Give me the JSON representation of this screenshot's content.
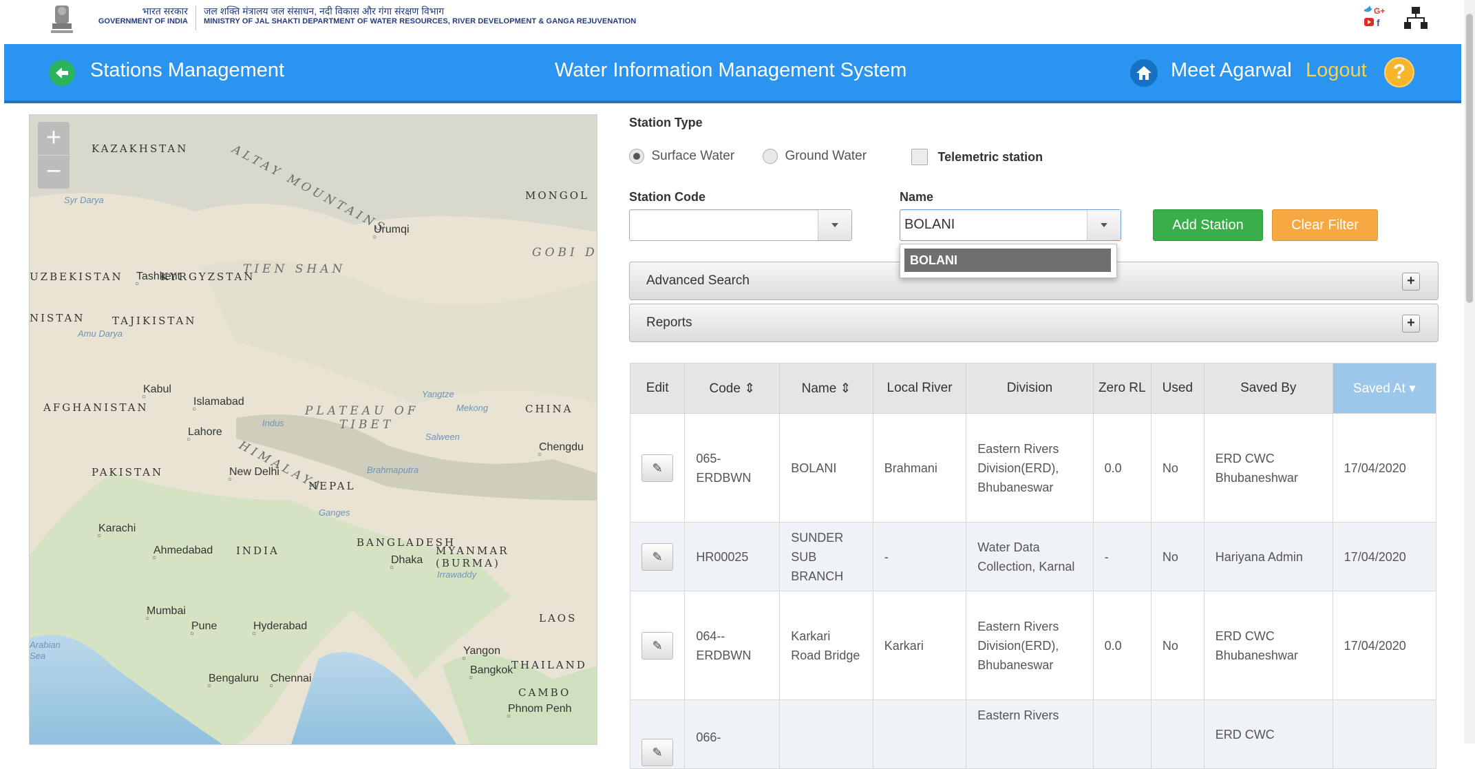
{
  "gov": {
    "hindi": "भारत सरकार",
    "english": "GOVERNMENT OF INDIA",
    "ministry_hindi": "जल शक्ति मंत्रालय जल संसाधन, नदी विकास और गंगा संरक्षण विभाग",
    "ministry_english": "MINISTRY OF JAL SHAKTI DEPARTMENT OF WATER RESOURCES, RIVER DEVELOPMENT & GANGA REJUVENATION"
  },
  "header": {
    "page_title": "Stations Management",
    "app_title": "Water Information Management System",
    "user": "Meet Agarwal",
    "logout": "Logout",
    "help": "?"
  },
  "map": {
    "zoom_in": "+",
    "zoom_out": "−",
    "labels": [
      {
        "text": "KAZAKHSTAN",
        "cls": "country"
      },
      {
        "text": "ALTAY MOUNTAINS",
        "cls": "region"
      },
      {
        "text": "MONGOL",
        "cls": "country"
      },
      {
        "text": "Syr Darya",
        "cls": "water"
      },
      {
        "text": "Urumqi",
        "cls": "city"
      },
      {
        "text": "GOBI D",
        "cls": "region"
      },
      {
        "text": "UZBEKISTAN",
        "cls": "country"
      },
      {
        "text": "Tashkent",
        "cls": "city"
      },
      {
        "text": "KYRGYZSTAN",
        "cls": "country"
      },
      {
        "text": "TIEN SHAN",
        "cls": "region"
      },
      {
        "text": "NISTAN",
        "cls": "country"
      },
      {
        "text": "TAJIKISTAN",
        "cls": "country"
      },
      {
        "text": "Amu Darya",
        "cls": "water"
      },
      {
        "text": "Kabul",
        "cls": "city"
      },
      {
        "text": "Islamabad",
        "cls": "city"
      },
      {
        "text": "AFGHANISTAN",
        "cls": "country"
      },
      {
        "text": "PLATEAU OF",
        "cls": "region"
      },
      {
        "text": "TIBET",
        "cls": "region"
      },
      {
        "text": "CHINA",
        "cls": "country"
      },
      {
        "text": "Yangtze",
        "cls": "water"
      },
      {
        "text": "Mekong",
        "cls": "water"
      },
      {
        "text": "Indus",
        "cls": "water"
      },
      {
        "text": "Lahore",
        "cls": "city"
      },
      {
        "text": "HIMALAYA",
        "cls": "region"
      },
      {
        "text": "Salween",
        "cls": "water"
      },
      {
        "text": "Chengdu",
        "cls": "city"
      },
      {
        "text": "Brahmaputra",
        "cls": "water"
      },
      {
        "text": "PAKISTAN",
        "cls": "country"
      },
      {
        "text": "New Delhi",
        "cls": "city"
      },
      {
        "text": "NEPAL",
        "cls": "country"
      },
      {
        "text": "Ganges",
        "cls": "water"
      },
      {
        "text": "Karachi",
        "cls": "city"
      },
      {
        "text": "BANGLADESH",
        "cls": "country"
      },
      {
        "text": "Ahmedabad",
        "cls": "city"
      },
      {
        "text": "INDIA",
        "cls": "country"
      },
      {
        "text": "Dhaka",
        "cls": "city"
      },
      {
        "text": "MYANMAR",
        "cls": "country"
      },
      {
        "text": "(BURMA)",
        "cls": "country"
      },
      {
        "text": "Irrawaddy",
        "cls": "water"
      },
      {
        "text": "Mumbai",
        "cls": "city"
      },
      {
        "text": "Pune",
        "cls": "city"
      },
      {
        "text": "Hyderabad",
        "cls": "city"
      },
      {
        "text": "LAOS",
        "cls": "country"
      },
      {
        "text": "Arabian",
        "cls": "water"
      },
      {
        "text": "Sea",
        "cls": "water"
      },
      {
        "text": "Yangon",
        "cls": "city"
      },
      {
        "text": "THAILAND",
        "cls": "country"
      },
      {
        "text": "Bengaluru",
        "cls": "city"
      },
      {
        "text": "Chennai",
        "cls": "city"
      },
      {
        "text": "Bangkok",
        "cls": "city"
      },
      {
        "text": "CAMBO",
        "cls": "country"
      },
      {
        "text": "Phnom Penh",
        "cls": "city"
      }
    ]
  },
  "filters": {
    "station_type_label": "Station Type",
    "surface_water": "Surface Water",
    "ground_water": "Ground Water",
    "telemetric": "Telemetric station",
    "selected_type": "Surface Water",
    "station_code_label": "Station Code",
    "station_code_value": "",
    "name_label": "Name",
    "name_value": "BOLANI",
    "name_suggestion": "BOLANI",
    "add_station": "Add Station",
    "clear_filter": "Clear Filter"
  },
  "accordions": {
    "advanced_search": "Advanced Search",
    "reports": "Reports",
    "expand": "+"
  },
  "table": {
    "headers": [
      "Edit",
      "Code ⇕",
      "Name ⇕",
      "Local River",
      "Division",
      "Zero RL",
      "Used",
      "Saved By",
      "Saved At ▾"
    ],
    "rows": [
      {
        "code": "065-ERDBWN",
        "name": "BOLANI",
        "river": "Brahmani",
        "division": "Eastern Rivers Division(ERD), Bhubaneswar",
        "zero_rl": "0.0",
        "used": "No",
        "saved_by": "ERD CWC Bhubaneshwar",
        "saved_at": "17/04/2020"
      },
      {
        "code": "HR00025",
        "name": "SUNDER SUB BRANCH",
        "river": "-",
        "division": "Water Data Collection, Karnal",
        "zero_rl": "-",
        "used": "No",
        "saved_by": "Hariyana Admin",
        "saved_at": "17/04/2020"
      },
      {
        "code": "064--ERDBWN",
        "name": "Karkari Road Bridge",
        "river": "Karkari",
        "division": "Eastern Rivers Division(ERD), Bhubaneswar",
        "zero_rl": "0.0",
        "used": "No",
        "saved_by": "ERD CWC Bhubaneshwar",
        "saved_at": "17/04/2020"
      },
      {
        "code": "066-",
        "name": "",
        "river": "",
        "division": "Eastern Rivers",
        "zero_rl": "",
        "used": "",
        "saved_by": "ERD CWC",
        "saved_at": ""
      }
    ]
  },
  "colors": {
    "header_blue": "#2a94f0",
    "add_green": "#37b34a",
    "clear_orange": "#f7a942",
    "logout_yellow": "#f8d24c"
  }
}
